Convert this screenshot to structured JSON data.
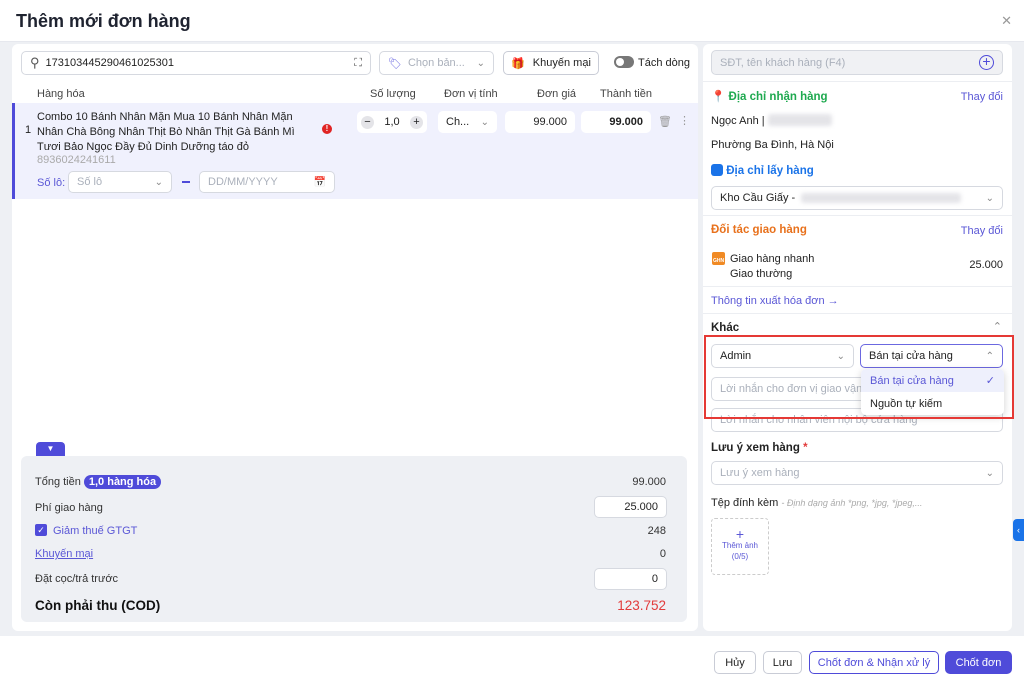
{
  "title": "Thêm mới đơn hàng",
  "colors": {
    "accent": "#4f4bd9",
    "green": "#1ea94f",
    "blue": "#1a73e8",
    "orange": "#e8711c",
    "red": "#e23b3b",
    "highlight": "#e53935"
  },
  "toolbar": {
    "search_value": "17310344529046102530​1",
    "price_placeholder": "Chọn bản...",
    "promo_label": "Khuyến mại",
    "split_label": "Tách dòng"
  },
  "table": {
    "headers": [
      "Hàng hóa",
      "Số lượng",
      "Đơn vị tính",
      "Đơn giá",
      "Thành tiền"
    ],
    "rows": [
      {
        "index": "1",
        "name": "Combo 10 Bánh Nhân Mặn Mua 10 Bánh Nhân Mặn Nhân Chà Bông Nhân Thịt Bò Nhân Thịt Gà Bánh Mì Tươi Bảo Ngọc Đầy Đủ Dinh Dưỡng táo đỏ",
        "barcode": "8936024241611",
        "quantity": "1,0",
        "unit": "Ch...",
        "price": "99.000",
        "total": "99.000",
        "lot_label": "Số lô:",
        "lot_placeholder": "Số lô",
        "date_placeholder": "DD/MM/YYYY"
      }
    ]
  },
  "summary": {
    "total_label": "Tổng tiền",
    "items_badge": "1,0 hàng hóa",
    "total_value": "99.000",
    "shipping_label": "Phí giao hàng",
    "shipping_value": "25.000",
    "vat_label": "Giảm thuế GTGT",
    "vat_checked": true,
    "vat_value": "248",
    "promo_label": "Khuyến mại",
    "promo_value": "0",
    "deposit_label": "Đặt cọc/trả trước",
    "deposit_value": "0",
    "cod_label": "Còn phải thu (COD)",
    "cod_value": "123.752"
  },
  "customer": {
    "placeholder": "SĐT, tên khách hàng (F4)"
  },
  "receive": {
    "title": "Địa chỉ nhận hàng",
    "change": "Thay đổi",
    "name": "Ngọc Anh",
    "address": "Phường Ba Đình, Hà Nội"
  },
  "pickup": {
    "title": "Địa chỉ lấy hàng",
    "value": "Kho Cầu Giấy -"
  },
  "shipping": {
    "title": "Đối tác giao hàng",
    "change": "Thay đổi",
    "carrier": "Giao hàng nhanh",
    "service": "Giao thường",
    "fee": "25.000",
    "invoice_link": "Thông tin xuất hóa đơn →"
  },
  "other": {
    "title": "Khác",
    "staff": "Admin",
    "source": "Bán tại cửa hàng",
    "source_options": [
      {
        "label": "Bán tại cửa hàng",
        "selected": true
      },
      {
        "label": "Nguồn tự kiếm",
        "selected": false
      }
    ],
    "carrier_note_placeholder": "Lời nhắn cho đơn vị giao vận (...",
    "internal_note_placeholder": "Lời nhắn cho nhân viên nội bộ cửa hàng",
    "inspect_label": "Lưu ý xem hàng",
    "inspect_placeholder": "Lưu ý xem hàng",
    "attach_label": "Tệp đính kèm",
    "attach_hint": "- Định dạng ảnh *png, *jpg, *jpeg,...",
    "add_image": "Thêm ảnh",
    "add_image_count": "(0/5)"
  },
  "footer": {
    "cancel": "Hủy",
    "save": "Lưu",
    "confirm_process": "Chốt đơn & Nhận xử lý",
    "confirm": "Chốt đơn"
  }
}
